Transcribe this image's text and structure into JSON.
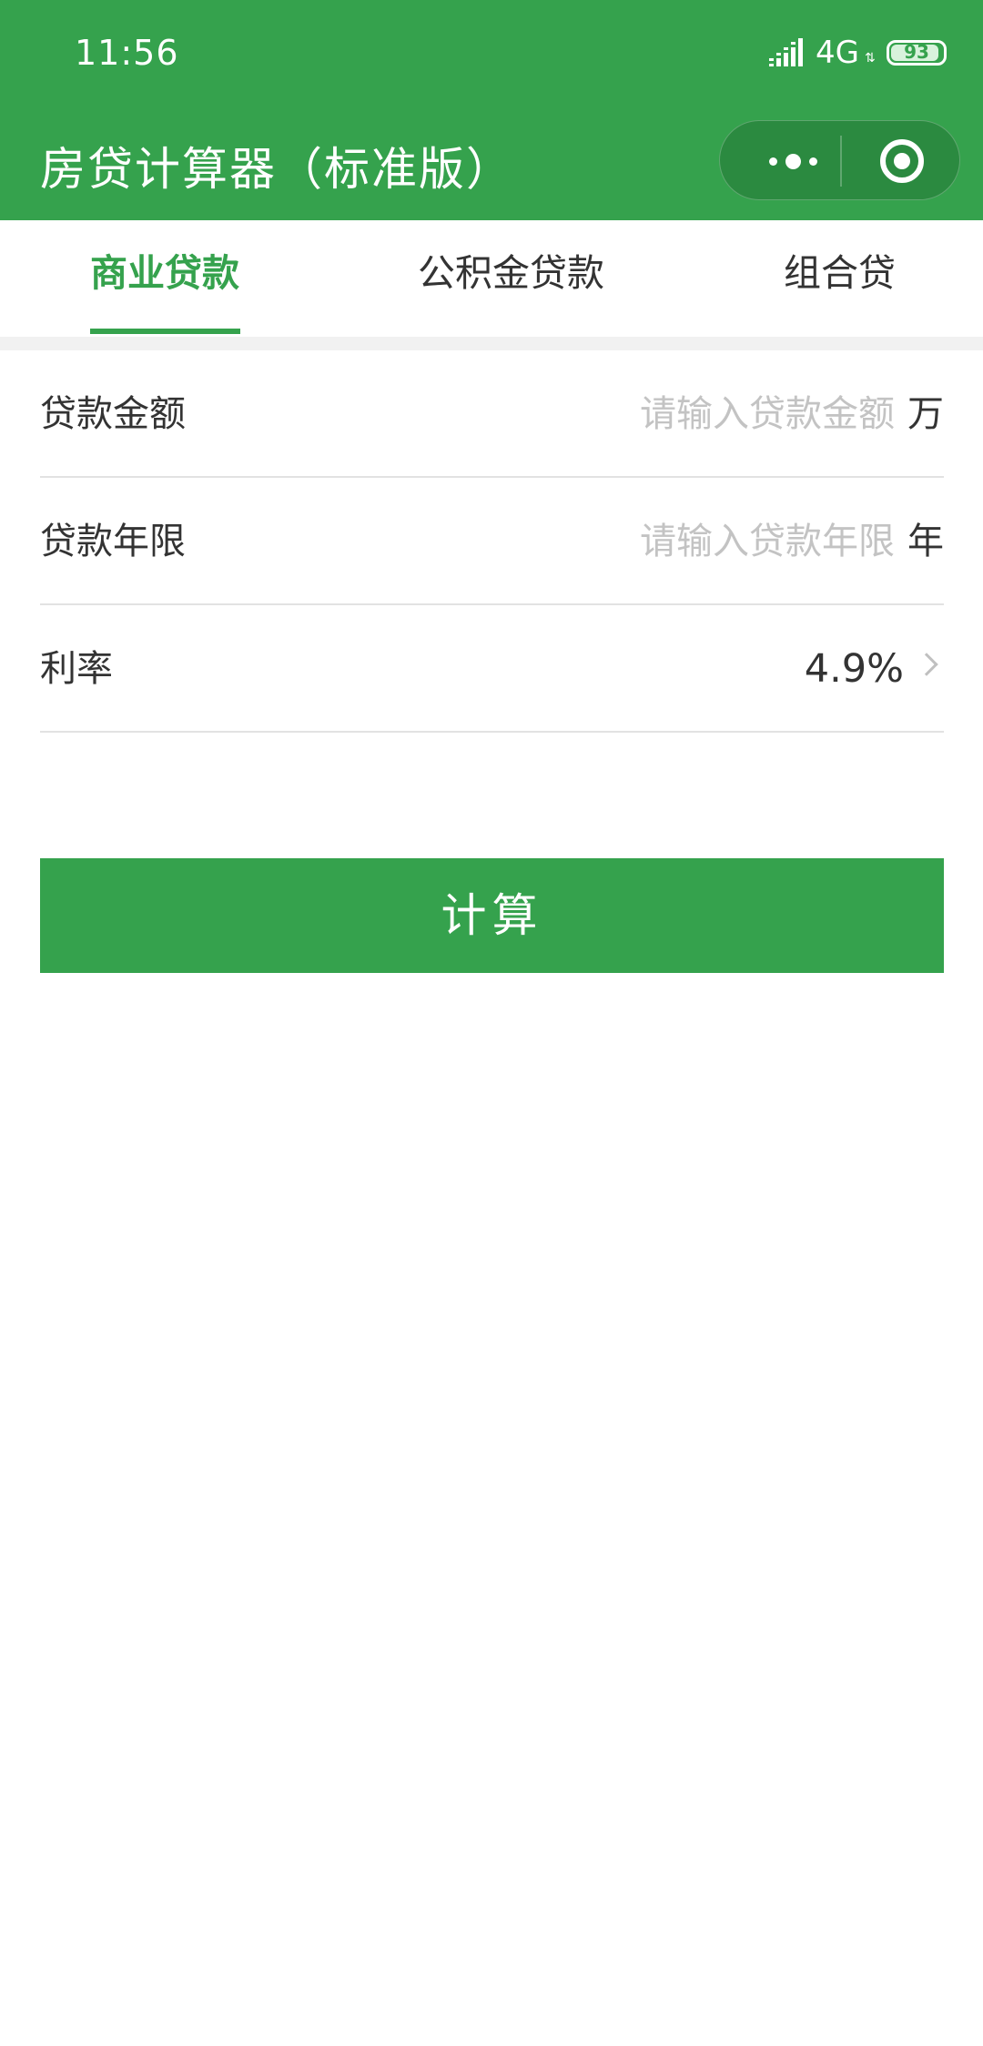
{
  "status_bar": {
    "time": "11:56",
    "network": "4G",
    "network_arrows": "⇅",
    "battery": "93",
    "battery_level_percent": 93
  },
  "header": {
    "title": "房贷计算器（标准版）",
    "color": "#35a24d",
    "more_icon": "more-dots-icon",
    "close_icon": "record-circle-icon"
  },
  "tabs": [
    {
      "label": "商业贷款",
      "active": true
    },
    {
      "label": "公积金贷款",
      "active": false
    },
    {
      "label": "组合贷",
      "active": false
    }
  ],
  "form": {
    "amount": {
      "label": "贷款金额",
      "placeholder": "请输入贷款金额",
      "value": "",
      "unit": "万"
    },
    "years": {
      "label": "贷款年限",
      "placeholder": "请输入贷款年限",
      "value": "",
      "unit": "年"
    },
    "rate": {
      "label": "利率",
      "value": "4.9%",
      "icon": "chevron-right-icon"
    }
  },
  "calculate_button": {
    "label": "计算"
  }
}
